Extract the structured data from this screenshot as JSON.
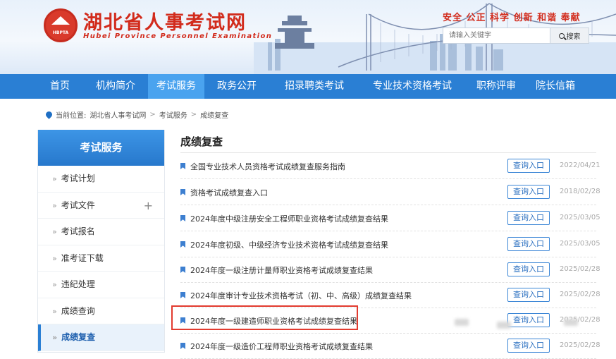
{
  "header": {
    "logo_text": "HBPTA",
    "site_title": "湖北省人事考试网",
    "site_subtitle": "Hubei Province Personnel Examination",
    "slogan": "安全 公正 科学 创新 和谐 奉献",
    "search": {
      "placeholder": "请输入关键字",
      "button_label": "搜索"
    }
  },
  "nav": {
    "items": [
      {
        "label": "首页"
      },
      {
        "label": "机构简介"
      },
      {
        "label": "考试服务",
        "active": true
      },
      {
        "label": "政务公开"
      },
      {
        "label": "招录聘类考试"
      },
      {
        "label": "专业技术资格考试"
      },
      {
        "label": "职称评审"
      },
      {
        "label": "院长信箱"
      }
    ]
  },
  "breadcrumb": {
    "prefix": "当前位置:",
    "items": [
      "湖北省人事考试网",
      "考试服务",
      "成绩复查"
    ],
    "separator": ">"
  },
  "sidebar": {
    "heading": "考试服务",
    "items": [
      {
        "label": "考试计划"
      },
      {
        "label": "考试文件",
        "expandable": true
      },
      {
        "label": "考试报名"
      },
      {
        "label": "准考证下载"
      },
      {
        "label": "违纪处理"
      },
      {
        "label": "成绩查询"
      },
      {
        "label": "成绩复查",
        "active": true
      }
    ],
    "chevron": "»",
    "plus": "+"
  },
  "main": {
    "title": "成绩复查",
    "button_label": "查询入口",
    "rows": [
      {
        "title": "全国专业技术人员资格考试成绩复查服务指南",
        "date": "2022/04/21"
      },
      {
        "title": "资格考试成绩复查入口",
        "date": "2018/02/28"
      },
      {
        "title": "2024年度中级注册安全工程师职业资格考试成绩复查结果",
        "date": "2025/03/05"
      },
      {
        "title": "2024年度初级、中级经济专业技术资格考试成绩复查结果",
        "date": "2025/03/05"
      },
      {
        "title": "2024年度一级注册计量师职业资格考试成绩复查结果",
        "date": "2025/02/28"
      },
      {
        "title": "2024年度审计专业技术资格考试（初、中、高级）成绩复查结果",
        "date": "2025/02/28"
      },
      {
        "title": "2024年度一级建造师职业资格考试成绩复查结果",
        "date": "2025/02/28"
      },
      {
        "title": "2024年度一级造价工程师职业资格考试成绩复查结果",
        "date": "2025/02/28"
      }
    ]
  },
  "colors": {
    "brand_red": "#d22b1c",
    "nav_blue": "#2a7fd4",
    "nav_active": "#4aa3ef",
    "highlight_red": "#e23b2f"
  }
}
